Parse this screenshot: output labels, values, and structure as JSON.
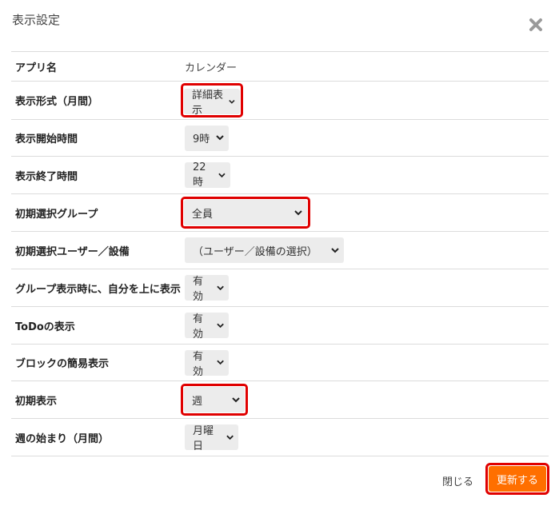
{
  "dialog": {
    "title": "表示設定"
  },
  "rows": [
    {
      "label": "アプリ名",
      "value": "カレンダー"
    },
    {
      "label": "表示形式（月間）",
      "value": "詳細表示"
    },
    {
      "label": "表示開始時間",
      "value": "9時"
    },
    {
      "label": "表示終了時間",
      "value": "22時"
    },
    {
      "label": "初期選択グループ",
      "value": "全員"
    },
    {
      "label": "初期選択ユーザー／設備",
      "value": "（ユーザー／設備の選択）"
    },
    {
      "label": "グループ表示時に、自分を上に表示",
      "value": "有効"
    },
    {
      "label": "ToDoの表示",
      "value": "有効"
    },
    {
      "label": "ブロックの簡易表示",
      "value": "有効"
    },
    {
      "label": "初期表示",
      "value": "週"
    },
    {
      "label": "週の始まり（月間）",
      "value": "月曜日"
    }
  ],
  "footer": {
    "close_label": "閉じる",
    "update_label": "更新する"
  },
  "colors": {
    "highlight": "#e00000",
    "primary": "#ff6f00",
    "select_bg": "#ececec"
  },
  "icons": {
    "close": "close-x-icon",
    "dropdown": "chevron-down-icon"
  }
}
